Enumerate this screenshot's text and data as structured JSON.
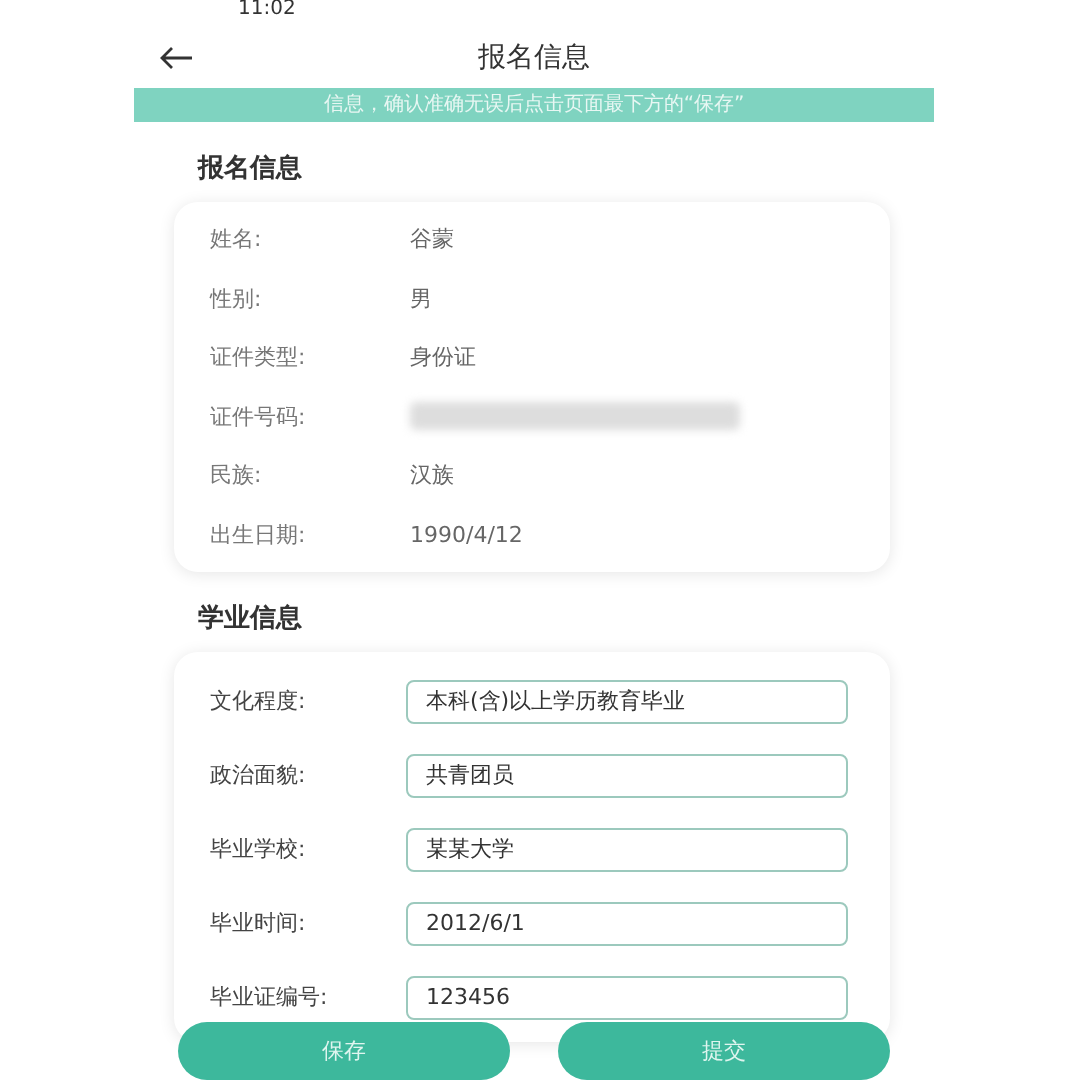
{
  "status_bar": {
    "time": "11:02"
  },
  "header": {
    "title": "报名信息"
  },
  "notice": "信息，确认准确无误后点击页面最下方的“保存”",
  "sections": [
    {
      "title": "报名信息",
      "kind": "info",
      "rows": [
        {
          "label": "姓名:",
          "value": "谷蒙",
          "kind": "text"
        },
        {
          "label": "性别:",
          "value": "男",
          "kind": "text"
        },
        {
          "label": "证件类型:",
          "value": "身份证",
          "kind": "text"
        },
        {
          "label": "证件号码:",
          "kind": "redacted"
        },
        {
          "label": "民族:",
          "value": "汉族",
          "kind": "text"
        },
        {
          "label": "出生日期:",
          "value": "1990/4/12",
          "kind": "text"
        }
      ]
    },
    {
      "title": "学业信息",
      "kind": "form",
      "rows": [
        {
          "label": "文化程度:",
          "value": "本科(含)以上学历教育毕业"
        },
        {
          "label": "政治面貌:",
          "value": "共青团员"
        },
        {
          "label": "毕业学校:",
          "value": "某某大学"
        },
        {
          "label": "毕业时间:",
          "value": "2012/6/1"
        },
        {
          "label": "毕业证编号:",
          "value": "123456"
        }
      ]
    }
  ],
  "buttons": [
    "保存",
    "提交"
  ]
}
